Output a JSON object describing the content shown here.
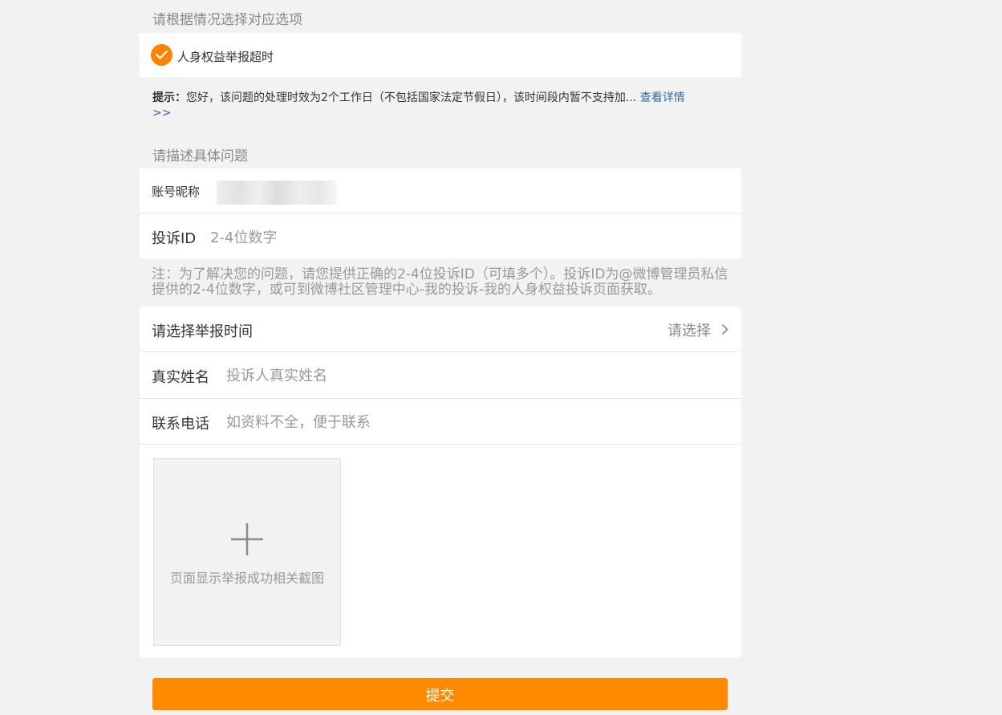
{
  "options_section": {
    "title": "请根据情况选择对应选项",
    "selected_option": "人身权益举报超时"
  },
  "hint": {
    "prefix": "提示：",
    "text": "您好，该问题的处理时效为2个工作日（不包括国家法定节假日），该时间段内暂不支持加...",
    "link": "查看详情",
    "link_tail": ">>"
  },
  "describe_section": {
    "title": "请描述具体问题"
  },
  "account": {
    "label": "账号昵称"
  },
  "complaint_id": {
    "label": "投诉ID",
    "placeholder": "2-4位数字"
  },
  "note": "注：为了解决您的问题，请您提供正确的2-4位投诉ID（可填多个）。投诉ID为@微博管理员私信提供的2-4位数字，或可到微博社区管理中心-我的投诉-我的人身权益投诉页面获取。",
  "report_time": {
    "label": "请选择举报时间",
    "value": "请选择"
  },
  "real_name": {
    "label": "真实姓名",
    "placeholder": "投诉人真实姓名"
  },
  "phone": {
    "label": "联系电话",
    "placeholder": "如资料不全，便于联系"
  },
  "upload": {
    "label": "页面显示举报成功相关截图"
  },
  "submit": {
    "label": "提交"
  },
  "colors": {
    "accent": "#ff8200",
    "link": "#2f6aa8",
    "background": "#f2f2f2"
  },
  "icons": [
    "check-icon",
    "chevron-right-icon",
    "plus-icon"
  ]
}
